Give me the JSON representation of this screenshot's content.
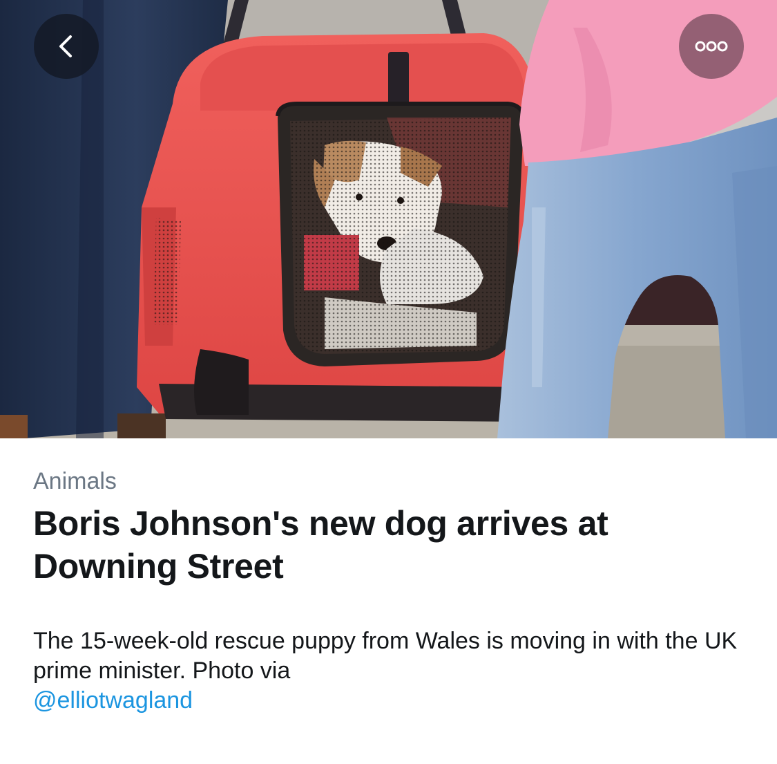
{
  "navigation": {
    "back_icon": "chevron-left-icon",
    "more_icon": "more-horizontal-icon"
  },
  "hero_image": {
    "subject": "dog-in-carrier-photo",
    "colors": {
      "carrier": "#e9504e",
      "mesh": "#2b2624",
      "jeans": "#8aaad0",
      "pink_top": "#f49dbb",
      "dark_trousers": "#23324d"
    }
  },
  "article": {
    "category": "Animals",
    "headline": "Boris Johnson's new dog arrives at Downing Street",
    "summary": "The 15-week-old rescue puppy from Wales is moving in with the UK prime minister. Photo via",
    "handle": "@elliotwagland"
  },
  "colors": {
    "category_text": "#6b7784",
    "headline_text": "#14171a",
    "link": "#1b95e0"
  }
}
